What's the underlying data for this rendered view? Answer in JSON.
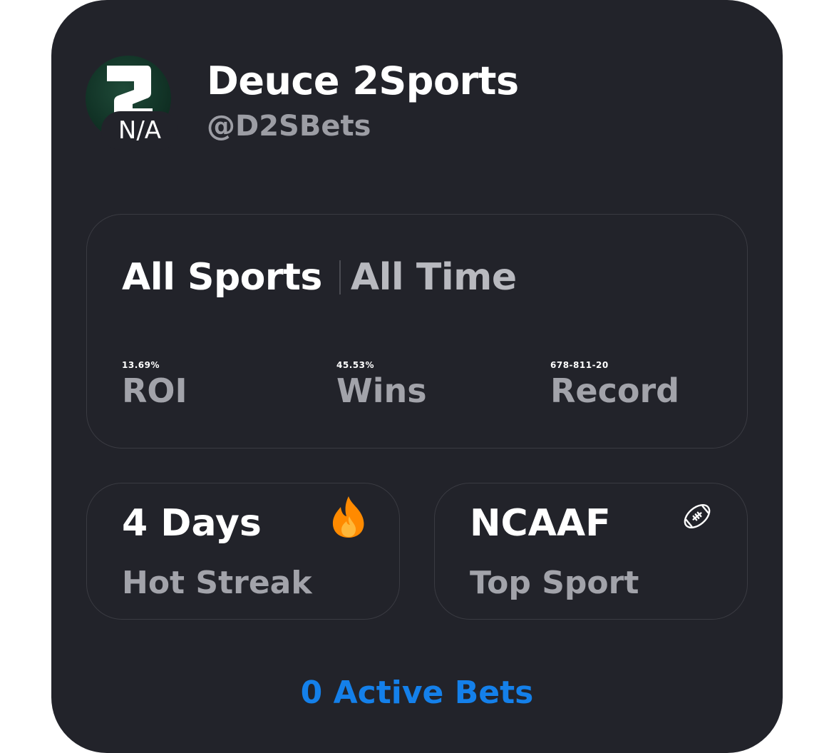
{
  "profile": {
    "name": "Deuce 2Sports",
    "handle": "@D2SBets",
    "avatar_badge": "N/A"
  },
  "stats": {
    "filter_sport": "All Sports",
    "filter_time": "All Time",
    "items": [
      {
        "value": "13.69%",
        "label": "ROI"
      },
      {
        "value": "45.53%",
        "label": "Wins"
      },
      {
        "value": "678-811-20",
        "label": "Record"
      }
    ]
  },
  "streak": {
    "title": "4 Days",
    "subtitle": "Hot Streak",
    "icon": "fire-icon"
  },
  "top_sport": {
    "title": "NCAAF",
    "subtitle": "Top Sport",
    "icon": "football-icon"
  },
  "active_bets": {
    "label": "0 Active Bets"
  },
  "colors": {
    "card_background": "#22232a",
    "panel_border": "#3a3b42",
    "accent_blue": "#1480ea",
    "muted_text": "#a2a3aa",
    "avatar_green": "#123427",
    "fire_orange": "#ff8a00"
  }
}
